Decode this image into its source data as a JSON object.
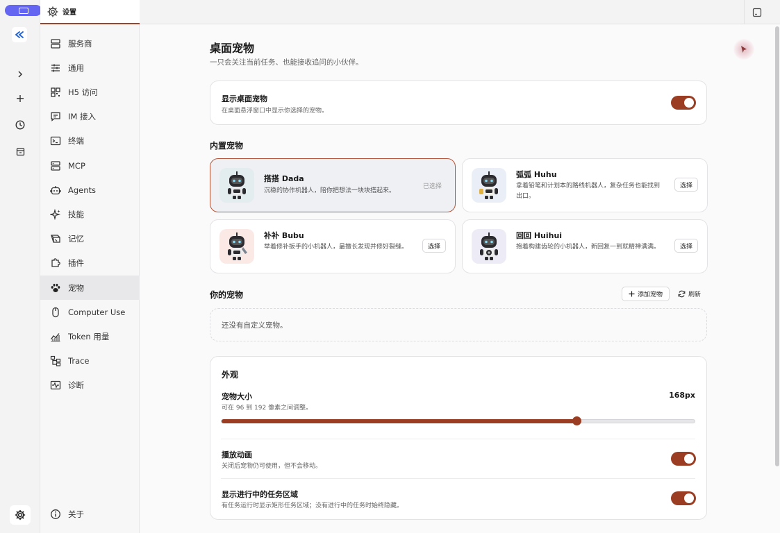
{
  "sidebar": {
    "header_label": "设置",
    "items": [
      {
        "label": "服务商",
        "icon": "server-icon"
      },
      {
        "label": "通用",
        "icon": "sliders-icon"
      },
      {
        "label": "H5 访问",
        "icon": "qrcode-icon"
      },
      {
        "label": "IM 接入",
        "icon": "chat-icon"
      },
      {
        "label": "终端",
        "icon": "terminal-icon"
      },
      {
        "label": "MCP",
        "icon": "server-stack-icon"
      },
      {
        "label": "Agents",
        "icon": "robot-icon"
      },
      {
        "label": "技能",
        "icon": "sparkles-icon"
      },
      {
        "label": "记忆",
        "icon": "memory-icon"
      },
      {
        "label": "插件",
        "icon": "puzzle-icon"
      },
      {
        "label": "宠物",
        "icon": "paw-icon"
      },
      {
        "label": "Computer Use",
        "icon": "mouse-icon"
      },
      {
        "label": "Token 用量",
        "icon": "chart-line-icon"
      },
      {
        "label": "Trace",
        "icon": "tree-icon"
      },
      {
        "label": "诊断",
        "icon": "pulse-icon"
      }
    ],
    "about_label": "关于"
  },
  "page": {
    "title": "桌面宠物",
    "subtitle": "一只会关注当前任务、也能接收追问的小伙伴。"
  },
  "show_pet": {
    "title": "显示桌面宠物",
    "desc": "在桌面悬浮窗口中显示你选择的宠物。",
    "enabled": true
  },
  "builtin": {
    "heading": "内置宠物",
    "pets": [
      {
        "name": "搭搭 Dada",
        "desc": "沉稳的协作机器人，陪你把想法一块块搭起来。",
        "status": "已选择",
        "bg": "#e3ecef"
      },
      {
        "name": "弧弧 Huhu",
        "desc": "拿着铅笔和计划本的路线机器人，复杂任务也能找到出口。",
        "action": "选择",
        "bg": "#eaeef7"
      },
      {
        "name": "补补 Bubu",
        "desc": "举着修补扳手的小机器人，最擅长发现并修好裂缝。",
        "action": "选择",
        "bg": "#fbe9e6"
      },
      {
        "name": "回回 Huihui",
        "desc": "抱着构建齿轮的小机器人，新回复一到就精神满满。",
        "action": "选择",
        "bg": "#ecebf6"
      }
    ]
  },
  "yours": {
    "heading": "你的宠物",
    "add_label": "添加宠物",
    "refresh_label": "刷新",
    "empty_text": "还没有自定义宠物。"
  },
  "appearance": {
    "heading": "外观",
    "size_title": "宠物大小",
    "size_desc": "可在 96 到 192 像素之间调整。",
    "size_value": "168px",
    "size_fraction": 0.75,
    "anim_title": "播放动画",
    "anim_desc": "关闭后宠物仍可使用，但不会移动。",
    "anim_enabled": true,
    "task_title": "显示进行中的任务区域",
    "task_desc": "有任务运行时显示矩形任务区域；没有进行中的任务时始终隐藏。",
    "task_enabled": true
  },
  "colors": {
    "accent": "#9a3d22",
    "rail_pill": "#6466f1"
  }
}
